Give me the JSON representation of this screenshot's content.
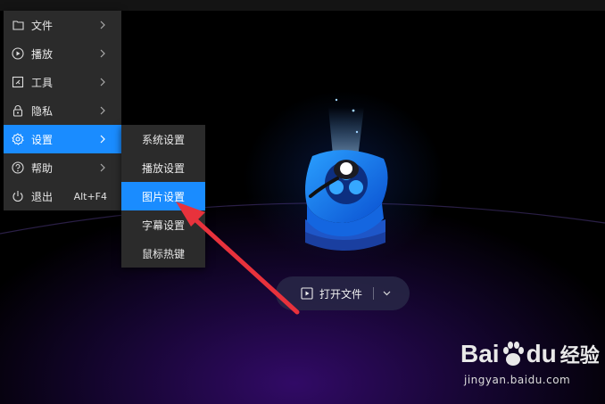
{
  "main_menu": {
    "items": [
      {
        "label": "文件",
        "icon": "folder-icon",
        "submenu": true
      },
      {
        "label": "播放",
        "icon": "play-circle-icon",
        "submenu": true
      },
      {
        "label": "工具",
        "icon": "tools-icon",
        "submenu": true
      },
      {
        "label": "隐私",
        "icon": "lock-icon",
        "submenu": true
      },
      {
        "label": "设置",
        "icon": "gear-icon",
        "submenu": true,
        "active": true
      },
      {
        "label": "帮助",
        "icon": "help-icon",
        "submenu": true
      },
      {
        "label": "退出",
        "icon": "power-icon",
        "shortcut": "Alt+F4"
      }
    ]
  },
  "settings_submenu": {
    "items": [
      {
        "label": "系统设置"
      },
      {
        "label": "播放设置"
      },
      {
        "label": "图片设置",
        "active": true
      },
      {
        "label": "字幕设置"
      },
      {
        "label": "鼠标热键"
      }
    ]
  },
  "open_file_button": {
    "label": "打开文件",
    "icon": "play-file-icon",
    "dropdown_icon": "chevron-down-icon"
  },
  "watermark": {
    "bai": "Bai",
    "du": "du",
    "jingyan": "经验",
    "url": "jingyan.baidu.com",
    "icon": "baidu-paw-icon"
  },
  "colors": {
    "accent": "#1a8cff",
    "menu_bg": "#2b2b2b",
    "annotation_arrow": "#e8323c"
  }
}
